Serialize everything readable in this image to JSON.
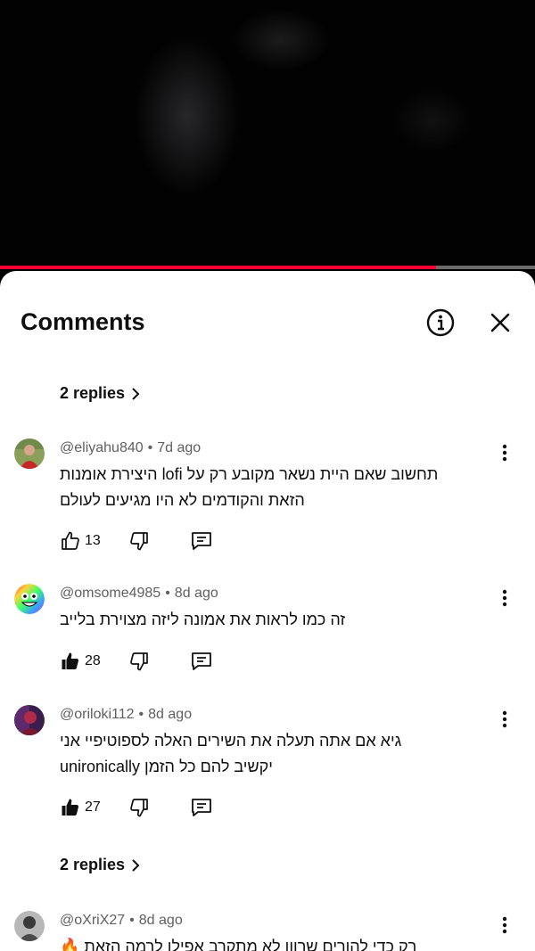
{
  "progress": {
    "fraction": 0.815
  },
  "sheet": {
    "title": "Comments",
    "info_icon": "info-icon",
    "close_icon": "close-icon"
  },
  "replies_top": {
    "label": "2 replies"
  },
  "comments": [
    {
      "author": "@eliyahu840",
      "time": "7d ago",
      "lines": [
        "תחשוב שאם היית נשאר מקובע רק על lofi היצירת אומנות",
        "הזאת והקודמים לא היו מגיעים לעולם"
      ],
      "likes": "13",
      "liked": false
    },
    {
      "author": "@omsome4985",
      "time": "8d ago",
      "lines": [
        "זה כמו לראות את אמונה ליזה מצוירת בלייב"
      ],
      "likes": "28",
      "liked": true
    },
    {
      "author": "@oriloki112",
      "time": "8d ago",
      "lines": [
        "גיא אם אתה תעלה את השירים האלה לספוטיפיי אני",
        "יקשיב להם כל הזמן unironically"
      ],
      "likes": "27",
      "liked": true
    },
    {
      "author": "@oXriX27",
      "time": "8d ago",
      "lines": [
        "רק כדי להורים שרווו לא מתקרב אפילו לרמה הזאת 🔥"
      ],
      "likes": "",
      "liked": false
    }
  ],
  "replies_bottom": {
    "label": "2 replies"
  },
  "colors": {
    "accent": "#ff0033",
    "text": "#0f0f0f",
    "meta": "#606060"
  }
}
